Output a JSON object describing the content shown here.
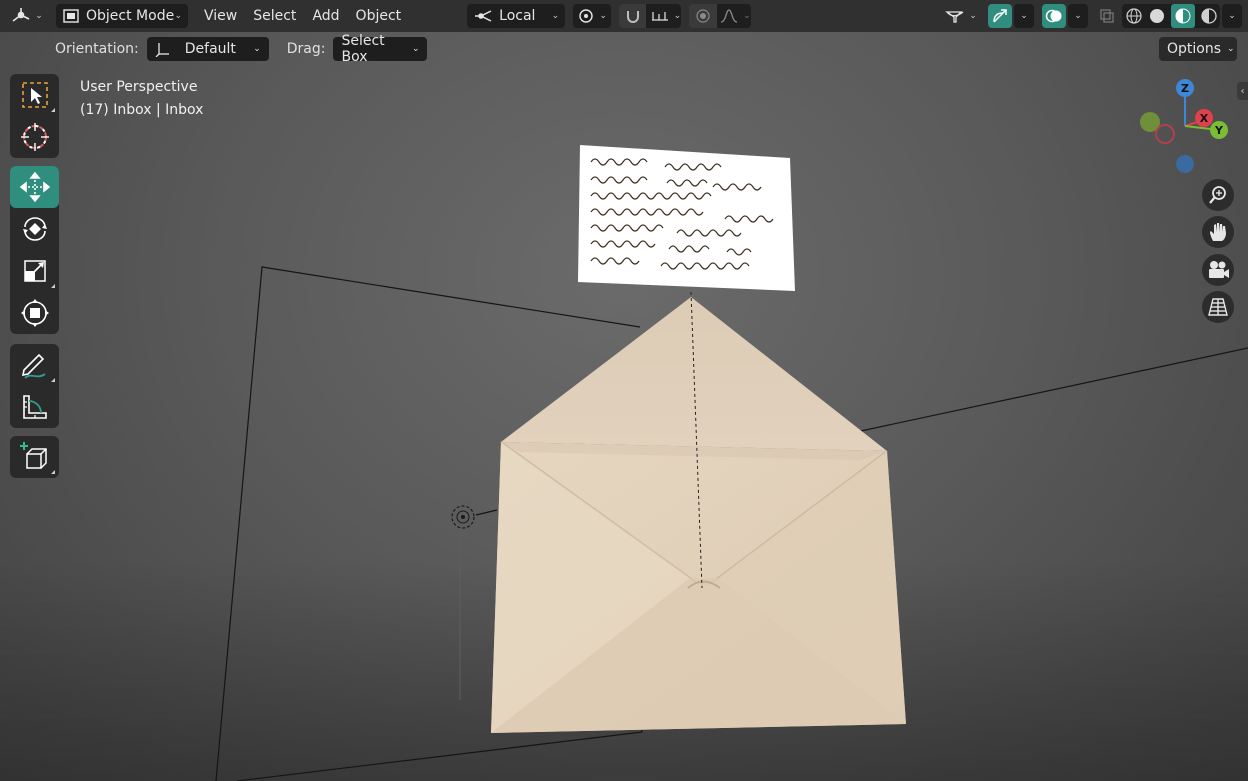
{
  "header": {
    "editor_type_icon": "transform-gizmo-icon",
    "mode_label": "Object Mode",
    "menus": [
      "View",
      "Select",
      "Add",
      "Object"
    ],
    "pivot_label": "Local",
    "options_label": "Options"
  },
  "tool_settings": {
    "orientation_label": "Orientation:",
    "orientation_value": "Default",
    "drag_label": "Drag:",
    "drag_value": "Select Box"
  },
  "toolbar": {
    "tools": [
      {
        "name": "select-box-tool",
        "icon": "cursor-box-icon",
        "active": false
      },
      {
        "name": "cursor-tool",
        "icon": "3d-cursor-icon",
        "active": false
      },
      {
        "name": "move-tool",
        "icon": "move-arrows-icon",
        "active": true
      },
      {
        "name": "rotate-tool",
        "icon": "rotate-icon",
        "active": false
      },
      {
        "name": "scale-tool",
        "icon": "scale-icon",
        "active": false
      },
      {
        "name": "transform-tool",
        "icon": "transform-icon",
        "active": false
      },
      {
        "name": "annotate-tool",
        "icon": "pencil-icon",
        "active": false
      },
      {
        "name": "measure-tool",
        "icon": "ruler-icon",
        "active": false
      },
      {
        "name": "add-cube-tool",
        "icon": "add-cube-icon",
        "active": false
      }
    ]
  },
  "viewport": {
    "view_name": "User Perspective",
    "object_info": "(17) Inbox | Inbox"
  },
  "gizmo": {
    "axes": [
      "Z",
      "X",
      "Y"
    ],
    "colors": {
      "x": "#e0404d",
      "y": "#7bbd32",
      "z": "#3d86d8"
    }
  },
  "nav_buttons": [
    "zoom-icon",
    "hand-pan-icon",
    "camera-icon",
    "perspective-grid-icon"
  ],
  "colors": {
    "accent": "#2f8e7e",
    "header_bg": "#303030",
    "envelope": "#e2d2bd",
    "letter": "#ffffff"
  }
}
